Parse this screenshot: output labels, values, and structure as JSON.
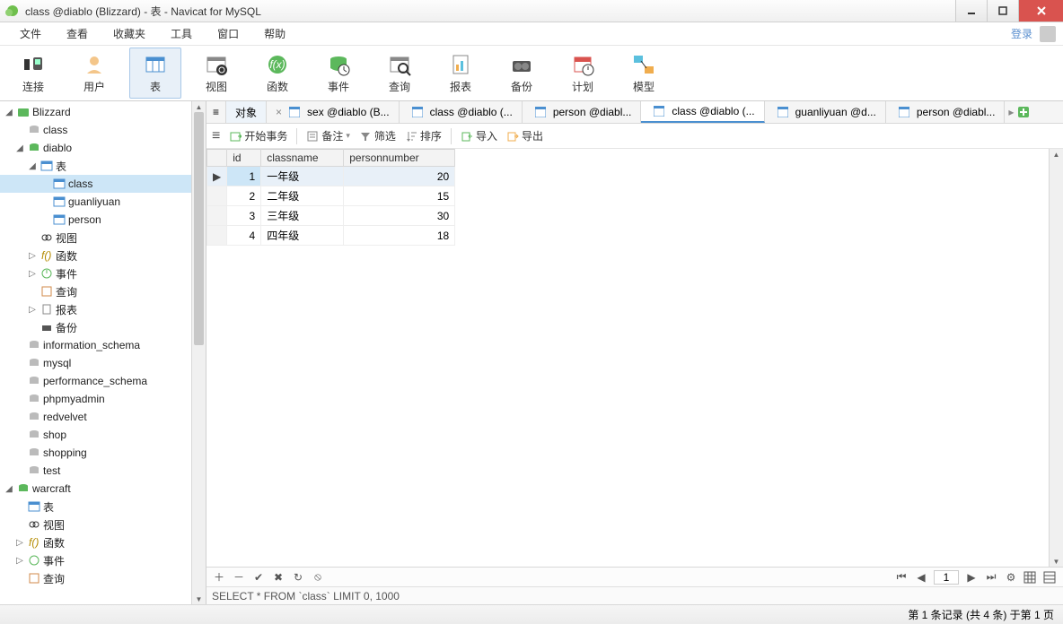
{
  "title": "class @diablo (Blizzard) - 表 - Navicat for MySQL",
  "menu": {
    "file": "文件",
    "view": "查看",
    "fav": "收藏夹",
    "tools": "工具",
    "window": "窗口",
    "help": "帮助",
    "login": "登录"
  },
  "toolbar": {
    "connect": "连接",
    "user": "用户",
    "table": "表",
    "view": "视图",
    "func": "函数",
    "event": "事件",
    "query": "查询",
    "report": "报表",
    "backup": "备份",
    "plan": "计划",
    "model": "模型"
  },
  "tree": {
    "conn_blizzard": "Blizzard",
    "class_top": "class",
    "diablo": "diablo",
    "tables": "表",
    "t_class": "class",
    "t_guanliyuan": "guanliyuan",
    "t_person": "person",
    "views": "视图",
    "funcs": "函数",
    "events": "事件",
    "queries": "查询",
    "reports": "报表",
    "backups": "备份",
    "info_schema": "information_schema",
    "mysql": "mysql",
    "perf_schema": "performance_schema",
    "phpmyadmin": "phpmyadmin",
    "redvelvet": "redvelvet",
    "shop": "shop",
    "shopping": "shopping",
    "test": "test",
    "conn_warcraft": "warcraft",
    "wc_tables": "表",
    "wc_views": "视图",
    "wc_funcs": "函数",
    "wc_events": "事件",
    "wc_queries": "查询"
  },
  "tabs": {
    "objects": "对象",
    "t1": "sex @diablo (B...",
    "t2": "class @diablo (...",
    "t3": "person @diabl...",
    "t4": "class @diablo (...",
    "t5": "guanliyuan @d...",
    "t6": "person @diabl..."
  },
  "subtoolbar": {
    "hamb": "≡",
    "begin": "开始事务",
    "memo": "备注",
    "filter": "筛选",
    "sort": "排序",
    "import": "导入",
    "export": "导出"
  },
  "grid": {
    "columns": [
      "id",
      "classname",
      "personnumber"
    ],
    "rows": [
      {
        "id": 1,
        "classname": "一年级",
        "personnumber": 20
      },
      {
        "id": 2,
        "classname": "二年级",
        "personnumber": 15
      },
      {
        "id": 3,
        "classname": "三年级",
        "personnumber": 30
      },
      {
        "id": 4,
        "classname": "四年级",
        "personnumber": 18
      }
    ]
  },
  "bottombar": {
    "page": "1"
  },
  "sqlrow": "SELECT * FROM `class` LIMIT 0, 1000",
  "statusbar": "第 1 条记录 (共 4 条) 于第 1 页"
}
